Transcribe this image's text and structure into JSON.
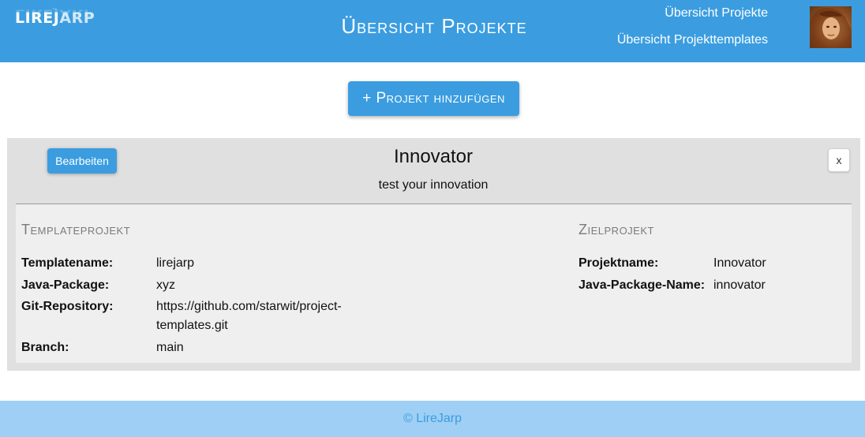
{
  "header": {
    "logo_text": "LIREJ",
    "logo_tail": "ARP",
    "title": "Übersicht Projekte",
    "nav": [
      {
        "label": "Übersicht Projekte"
      },
      {
        "label": "Übersicht Projekttemplates"
      }
    ]
  },
  "actions": {
    "add_project_label": "+ Projekt hinzufügen"
  },
  "project": {
    "edit_label": "Bearbeiten",
    "close_label": "x",
    "name": "Innovator",
    "description": "test your innovation",
    "template": {
      "heading": "Templateprojekt",
      "fields": [
        {
          "label": "Templatename:",
          "value": "lirejarp"
        },
        {
          "label": "Java-Package:",
          "value": "xyz"
        },
        {
          "label": "Git-Repository:",
          "value": "https://github.com/starwit/project-templates.git"
        },
        {
          "label": "Branch:",
          "value": "main"
        }
      ]
    },
    "target": {
      "heading": "Zielprojekt",
      "fields": [
        {
          "label": "Projektname:",
          "value": "Innovator"
        },
        {
          "label": "Java-Package-Name:",
          "value": "innovator"
        }
      ]
    }
  },
  "footer": {
    "text": "© LireJarp"
  }
}
